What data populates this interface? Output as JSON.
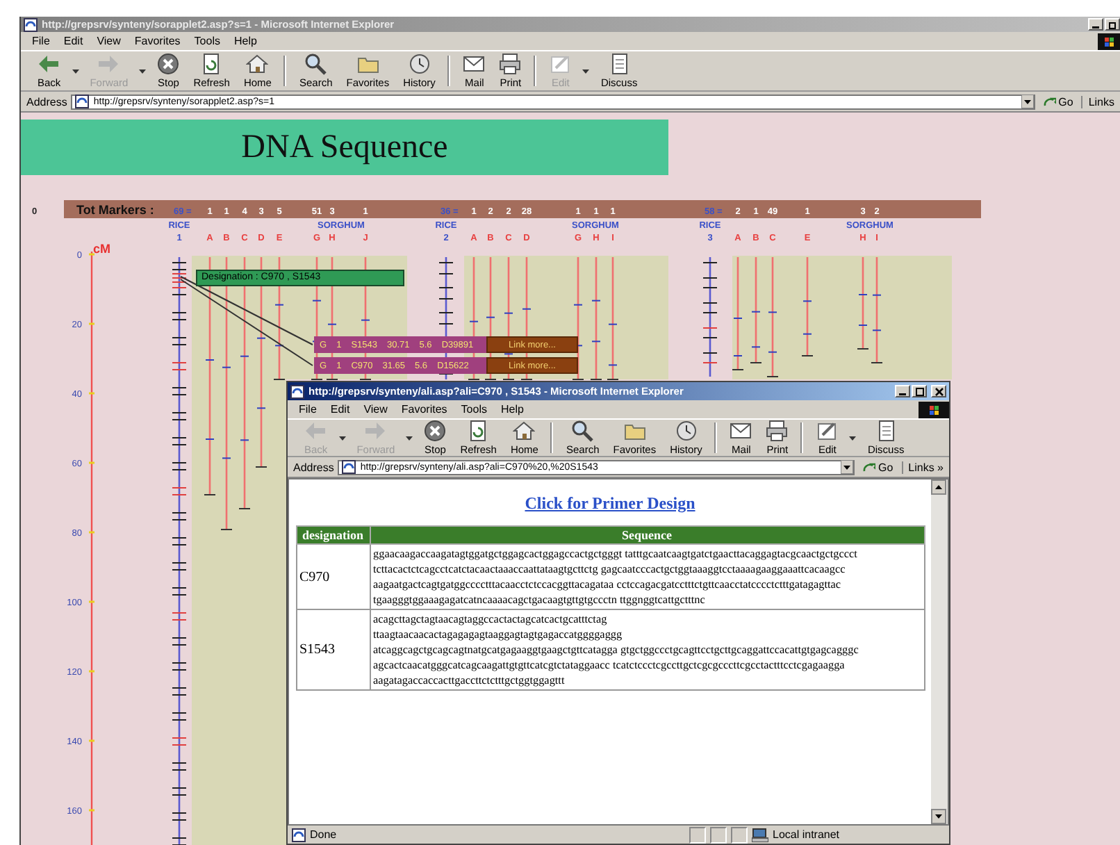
{
  "window": {
    "title": "http://grepsrv/synteny/sorapplet2.asp?s=1 - Microsoft Internet Explorer",
    "menu": [
      "File",
      "Edit",
      "View",
      "Favorites",
      "Tools",
      "Help"
    ],
    "toolbar": [
      {
        "label": "Back",
        "disabled": false
      },
      {
        "label": "Forward",
        "disabled": true
      },
      {
        "label": "Stop",
        "disabled": false
      },
      {
        "label": "Refresh",
        "disabled": false
      },
      {
        "label": "Home",
        "disabled": false
      },
      {
        "label": "Search",
        "disabled": false
      },
      {
        "label": "Favorites",
        "disabled": false
      },
      {
        "label": "History",
        "disabled": false
      },
      {
        "label": "Mail",
        "disabled": false
      },
      {
        "label": "Print",
        "disabled": false
      },
      {
        "label": "Edit",
        "disabled": true
      },
      {
        "label": "Discuss",
        "disabled": false
      }
    ],
    "address": {
      "label": "Address",
      "value": "http://grepsrv/synteny/sorapplet2.asp?s=1",
      "go": "Go",
      "links": "Links"
    }
  },
  "banner": "DNA Sequence",
  "map": {
    "origin": "0",
    "tot_label": "Tot Markers :",
    "cm_label": "cM",
    "axis_ticks": [
      "0",
      "20",
      "40",
      "60",
      "80",
      "100",
      "120",
      "140",
      "160"
    ],
    "groups": [
      {
        "rice_label": "RICE",
        "sorghum_label": "SORGHUM",
        "columns": [
          {
            "kind": "chromosome",
            "label": "1",
            "count": "69 ="
          },
          {
            "kind": "segment",
            "label": "A",
            "count": "1"
          },
          {
            "kind": "segment",
            "label": "B",
            "count": "1"
          },
          {
            "kind": "segment",
            "label": "C",
            "count": "4"
          },
          {
            "kind": "segment",
            "label": "D",
            "count": "3"
          },
          {
            "kind": "segment",
            "label": "E",
            "count": "5"
          },
          {
            "kind": "sorghum",
            "label": "G",
            "count": "51"
          },
          {
            "kind": "sorghum",
            "label": "H",
            "count": "3"
          },
          {
            "kind": "sorghum",
            "label": "J",
            "count": "1"
          }
        ]
      },
      {
        "rice_label": "RICE",
        "sorghum_label": "SORGHUM",
        "columns": [
          {
            "kind": "chromosome",
            "label": "2",
            "count": "36 ="
          },
          {
            "kind": "segment",
            "label": "A",
            "count": "1"
          },
          {
            "kind": "segment",
            "label": "B",
            "count": "2"
          },
          {
            "kind": "segment",
            "label": "C",
            "count": "2"
          },
          {
            "kind": "segment",
            "label": "D",
            "count": "28"
          },
          {
            "kind": "sorghum",
            "label": "G",
            "count": "1"
          },
          {
            "kind": "sorghum",
            "label": "H",
            "count": "1"
          },
          {
            "kind": "sorghum",
            "label": "I",
            "count": "1"
          }
        ]
      },
      {
        "rice_label": "RICE",
        "sorghum_label": "SORGHUM",
        "columns": [
          {
            "kind": "chromosome",
            "label": "3",
            "count": "58 ="
          },
          {
            "kind": "segment",
            "label": "A",
            "count": "2"
          },
          {
            "kind": "segment",
            "label": "B",
            "count": "1"
          },
          {
            "kind": "segment",
            "label": "C",
            "count": "49"
          },
          {
            "kind": "segment",
            "label": "E",
            "count": "1"
          },
          {
            "kind": "sorghum",
            "label": "H",
            "count": "3"
          },
          {
            "kind": "sorghum",
            "label": "I",
            "count": "2"
          }
        ]
      }
    ]
  },
  "tooltip": {
    "designation": "Designation : C970 , S1543",
    "rows": [
      {
        "fields": [
          "G",
          "1",
          "S1543",
          "30.71",
          "5.6",
          "D39891"
        ],
        "link": "Link more..."
      },
      {
        "fields": [
          "G",
          "1",
          "C970",
          "31.65",
          "5.6",
          "D15622"
        ],
        "link": "Link more..."
      }
    ]
  },
  "popup": {
    "title": "http://grepsrv/synteny/ali.asp?ali=C970 , S1543 - Microsoft Internet Explorer",
    "menu": [
      "File",
      "Edit",
      "View",
      "Favorites",
      "Tools",
      "Help"
    ],
    "toolbar": [
      {
        "label": "Back",
        "disabled": true
      },
      {
        "label": "Forward",
        "disabled": true
      },
      {
        "label": "Stop",
        "disabled": false
      },
      {
        "label": "Refresh",
        "disabled": false
      },
      {
        "label": "Home",
        "disabled": false
      },
      {
        "label": "Search",
        "disabled": false
      },
      {
        "label": "Favorites",
        "disabled": false
      },
      {
        "label": "History",
        "disabled": false
      },
      {
        "label": "Mail",
        "disabled": false
      },
      {
        "label": "Print",
        "disabled": false
      },
      {
        "label": "Edit",
        "disabled": false
      },
      {
        "label": "Discuss",
        "disabled": false
      }
    ],
    "address": {
      "label": "Address",
      "value": "http://grepsrv/synteny/ali.asp?ali=C970%20,%20S1543",
      "go": "Go",
      "links": "Links »"
    },
    "link": "Click for Primer Design",
    "table": {
      "columns": [
        "designation",
        "Sequence"
      ],
      "rows": [
        {
          "designation": "C970",
          "lines": [
            "ggaacaagaccaagatagtggatgctggagcactggagccactgctgggt tatttgcaatcaagtgatctgaacttacaggagtacgcaactgctgccct",
            "tcttacactctcagcctcatctacaactaaaccaattataagtgcttctg gagcaatcccactgctggtaaaggtcctaaaagaaggaaattcacaagcc",
            "aagaatgactcagtgatggcccctttacaacctctccacggttacagataa cctccagacgatcctttctgttcaacctatcccctctttgatagagttac",
            "tgaagggtggaaagagatcatncaaaacagctgacaagtgttgtgccctn ttggnggtcattgctttnc"
          ]
        },
        {
          "designation": "S1543",
          "lines": [
            "acagcttagctagtaacagtaggccactactagcatcactgcatttctag",
            "ttaagtaacaacactagagagagtaaggagtagtgagaccatggggaggg",
            "atcaggcagctgcagcagtnatgcatgagaaggtgaagctgttcatagga gtgctggccctgcagttcctgcttgcaggattccacattgtgagcagggc",
            "agcactcaacatgggcatcagcaagattgtgttcatcgtctataggaacc tcatctccctcgccttgctcgcgcccttcgcctactttcctcgagaagga",
            "aagatagaccaccacttgaccttctctttgctggtggagttt"
          ]
        }
      ]
    },
    "status": {
      "text": "Done",
      "zone": "Local intranet"
    }
  }
}
